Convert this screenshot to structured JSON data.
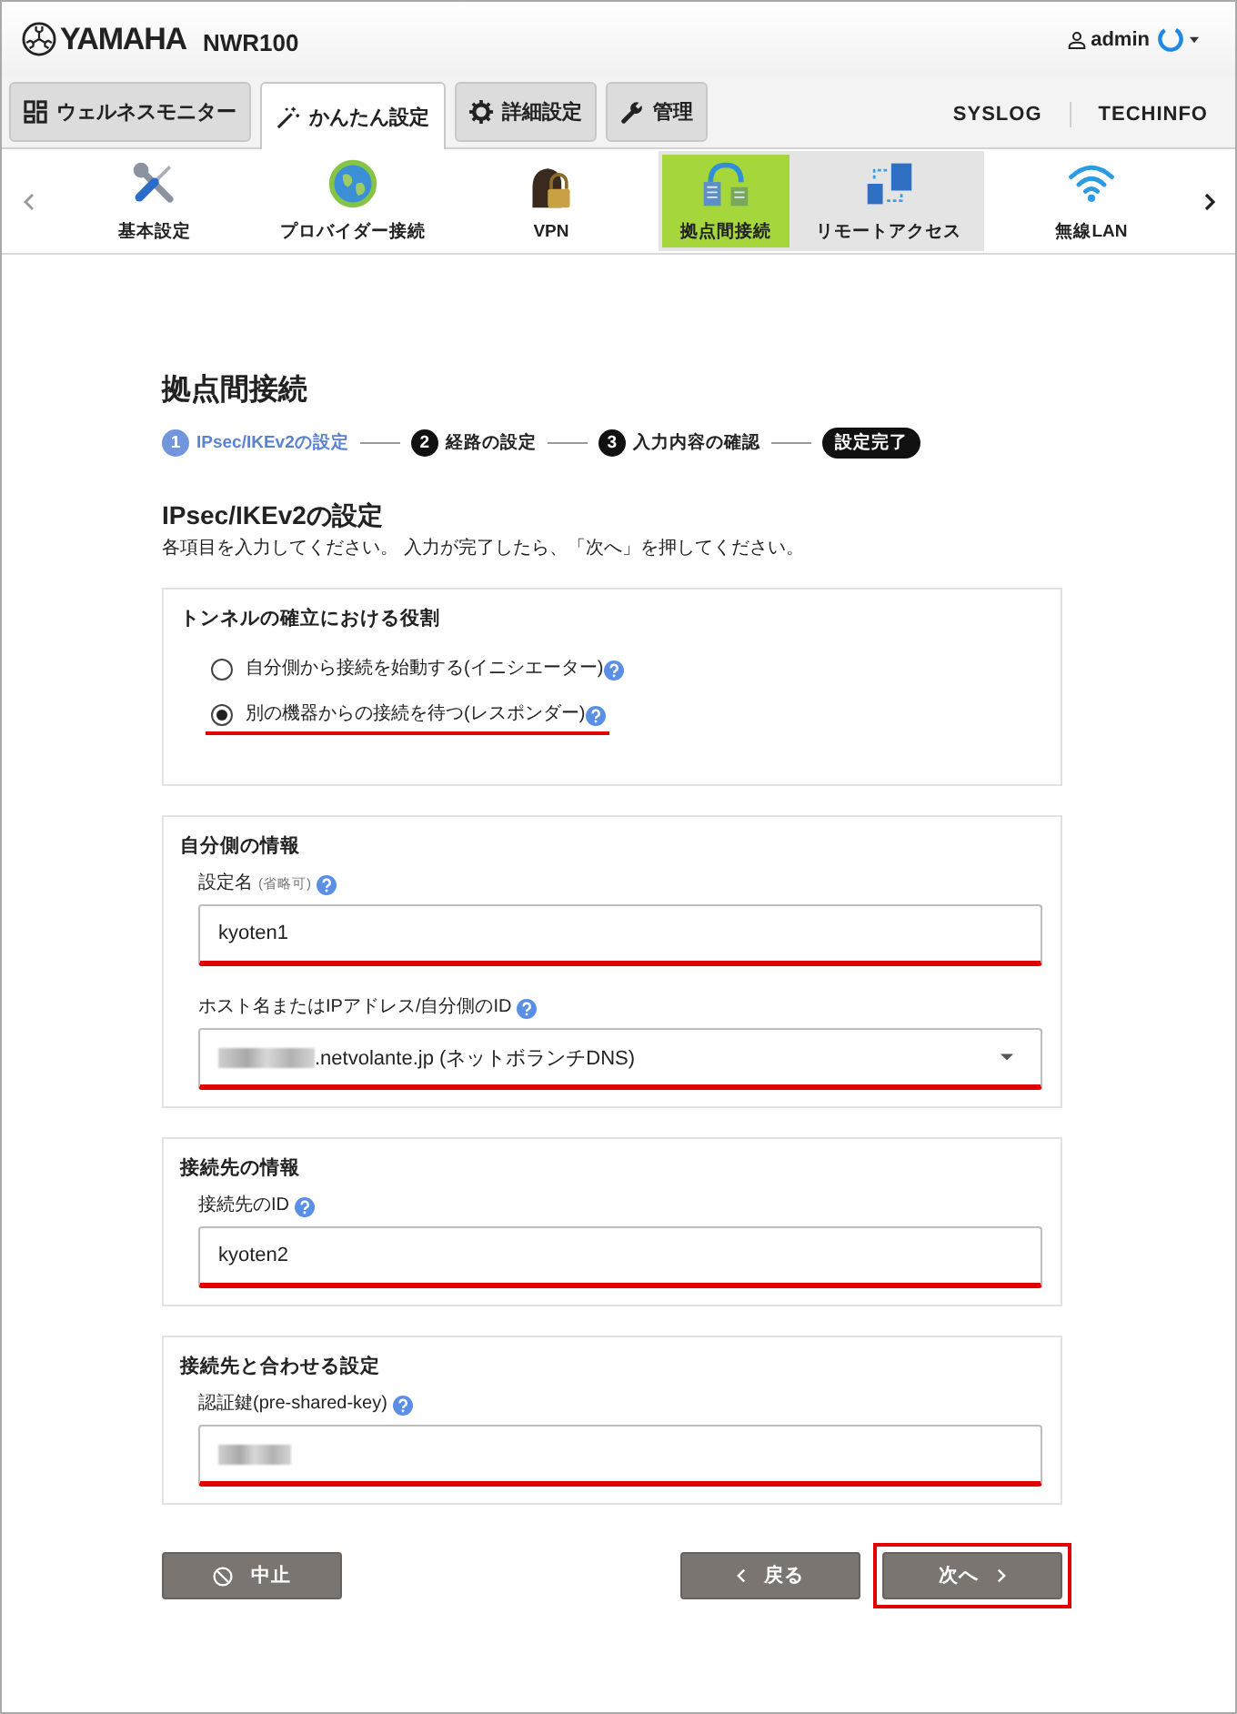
{
  "header": {
    "brand": "YAMAHA",
    "model": "NWR100",
    "user": "admin"
  },
  "tabs": [
    {
      "label": "ウェルネスモニター",
      "selected": false
    },
    {
      "label": "かんたん設定",
      "selected": true
    },
    {
      "label": "詳細設定",
      "selected": false
    },
    {
      "label": "管理",
      "selected": false
    }
  ],
  "header_links": [
    "SYSLOG",
    "TECHINFO"
  ],
  "nav": {
    "items": [
      {
        "label": "基本設定",
        "selected": false,
        "hovered": false
      },
      {
        "label": "プロバイダー接続",
        "selected": false,
        "hovered": false
      },
      {
        "label": "VPN",
        "selected": false,
        "hovered": false
      },
      {
        "label": "拠点間接続",
        "selected": true,
        "hovered": false
      },
      {
        "label": "リモートアクセス",
        "selected": false,
        "hovered": true
      },
      {
        "label": "無線LAN",
        "selected": false,
        "hovered": false
      }
    ]
  },
  "page": {
    "title": "拠点間接続",
    "steps": [
      {
        "kind": "numbered",
        "number": "1",
        "label": "IPsec/IKEv2の設定",
        "selected": true
      },
      {
        "kind": "numbered",
        "number": "2",
        "label": "経路の設定",
        "selected": false
      },
      {
        "kind": "numbered",
        "number": "3",
        "label": "入力内容の確認",
        "selected": false
      },
      {
        "kind": "final",
        "label": "設定完了",
        "selected": false
      }
    ],
    "heading": "IPsec/IKEv2の設定",
    "description": "各項目を入力してください。 入力が完了したら、「次へ」を押してください。"
  },
  "sections": [
    {
      "title": "トンネルの確立における役割",
      "fields": [
        {
          "kind": "radio",
          "label": "自分側から接続を始動する(イニシエーター)",
          "help": true,
          "selected": false,
          "highlighted": false
        },
        {
          "kind": "radio",
          "label": "別の機器からの接続を待つ(レスポンダー)",
          "help": true,
          "selected": true,
          "highlighted": true
        }
      ]
    },
    {
      "title": "自分側の情報",
      "fields": [
        {
          "kind": "text",
          "label": "設定名",
          "note": "(省略可)",
          "help": true,
          "value": "kyoten1",
          "redacted": false,
          "highlighted": true
        },
        {
          "kind": "select",
          "label": "ホスト名またはIPアドレス/自分側のID",
          "help": true,
          "value": ".netvolante.jp (ネットボランチDNS)",
          "redacted": true,
          "highlighted": true
        }
      ]
    },
    {
      "title": "接続先の情報",
      "fields": [
        {
          "kind": "text",
          "label": "接続先のID",
          "help": true,
          "value": "kyoten2",
          "redacted": false,
          "highlighted": true
        }
      ]
    },
    {
      "title": "接続先と合わせる設定",
      "fields": [
        {
          "kind": "password",
          "label": "認証鍵(pre-shared-key)",
          "help": true,
          "redacted": true,
          "highlighted": true
        }
      ]
    }
  ],
  "buttons": [
    {
      "kind": "cancel",
      "label": "中止",
      "highlighted": false
    },
    {
      "kind": "back",
      "label": "戻る",
      "highlighted": false
    },
    {
      "kind": "next",
      "label": "次へ",
      "highlighted": true
    }
  ]
}
